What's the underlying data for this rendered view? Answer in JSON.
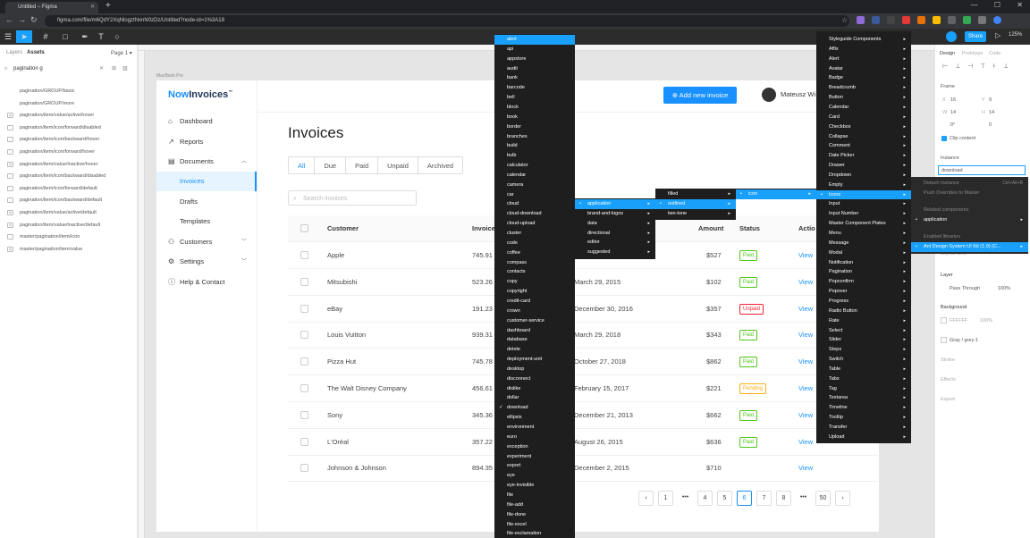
{
  "browser": {
    "tab_title": "Untitled – Figma",
    "new_tab": "+",
    "window_controls": "— ☐ ✕",
    "url": "figma.com/file/m6QdY2XqNlogztNxnN0zDz/Untitled?node-id=1%3A18"
  },
  "figma": {
    "share": "Share",
    "zoom": "125%",
    "left_tabs": [
      "Layers",
      "Assets"
    ],
    "page": "Page 1",
    "asset_search": "pagination g",
    "assets": [
      "pagination/GROUP/basic",
      "pagination/GROUP/more",
      "pagination/item/value/active/hover",
      "pagination/item/icon/forward/disabled",
      "pagination/item/icon/backward/hover",
      "pagination/item/icon/forward/hover",
      "pagination/item/value/inactive/hover",
      "pagination/item/icon/backward/disabled",
      "pagination/item/icon/forward/default",
      "pagination/item/icon/backward/default",
      "pagination/item/value/active/default",
      "pagination/item/value/inactive/default",
      "master/pagination/item/icon",
      "master/pagination/item/value"
    ],
    "asset_icons": [
      "",
      "",
      "99",
      "›",
      "‹",
      "›",
      "99",
      "‹",
      "›",
      "‹",
      "99",
      "99",
      "›",
      "99"
    ],
    "frame_label": "MacBook Pro",
    "right_tabs": [
      "Design",
      "Prototype",
      "Code"
    ],
    "frame_section": "Frame",
    "props": {
      "x": "16",
      "y": "9",
      "w": "14",
      "h": "14",
      "rot": "0°",
      "radius": "0"
    },
    "clip_content": "Clip content",
    "instance": "Instance",
    "instance_value": "download",
    "layer": "Layer",
    "pass_through": "Pass Through",
    "layer_opacity": "100%",
    "background": "Background",
    "bg_hex": "FFFFFF",
    "bg_opacity": "100%",
    "fill_style": "Gray / grey-1",
    "stroke": "Stroke",
    "effects": "Effects",
    "export": "Export",
    "faded_label": "Layout Grid"
  },
  "app": {
    "logo_a": "Now",
    "logo_b": "Invoices",
    "logo_tm": "™",
    "add_button": "Add new invoice",
    "user": "Mateusz Wi",
    "nav": {
      "dashboard": "Dashboard",
      "reports": "Reports",
      "documents": "Documents",
      "invoices": "Invoices",
      "drafts": "Drafts",
      "templates": "Templates",
      "customers": "Customers",
      "settings": "Settings",
      "help": "Help & Contact"
    },
    "title": "Invoices",
    "tabs": [
      "All",
      "Due",
      "Paid",
      "Unpaid",
      "Archived"
    ],
    "search_placeholder": "Search invoices",
    "columns": {
      "customer": "Customer",
      "invoice": "Invoice",
      "amount": "Amount",
      "status": "Status",
      "action": "Actio"
    },
    "rows": [
      {
        "customer": "Apple",
        "invoice": "745.91",
        "date": "",
        "amount": "$527",
        "status": "Paid",
        "action": "View"
      },
      {
        "customer": "Mitsubishi",
        "invoice": "523.26",
        "date": "March 29, 2015",
        "amount": "$102",
        "status": "Paid",
        "action": "View"
      },
      {
        "customer": "eBay",
        "invoice": "191.23",
        "date": "December 30, 2016",
        "amount": "$357",
        "status": "Unpaid",
        "action": "View"
      },
      {
        "customer": "Louis Vuitton",
        "invoice": "939.31",
        "date": "March 29, 2018",
        "amount": "$343",
        "status": "Paid",
        "action": "View"
      },
      {
        "customer": "Pizza Hut",
        "invoice": "745.78",
        "date": "October 27, 2018",
        "amount": "$862",
        "status": "Paid",
        "action": "View"
      },
      {
        "customer": "The Walt Disney Company",
        "invoice": "456.61",
        "date": "February 15, 2017",
        "amount": "$221",
        "status": "Pending",
        "action": "View"
      },
      {
        "customer": "Sony",
        "invoice": "345.36",
        "date": "December 21, 2013",
        "amount": "$662",
        "status": "Paid",
        "action": "View"
      },
      {
        "customer": "L'Oréal",
        "invoice": "357.22",
        "date": "August 26, 2015",
        "amount": "$636",
        "status": "Paid",
        "action": "View"
      },
      {
        "customer": "Johnson & Johnson",
        "invoice": "894.35",
        "date": "December 2, 2015",
        "amount": "$710",
        "status": "",
        "action": "View"
      }
    ],
    "pagination": [
      "‹",
      "1",
      "•••",
      "4",
      "5",
      "6",
      "7",
      "8",
      "•••",
      "50",
      "›"
    ],
    "current_page": "6"
  },
  "menus": {
    "icons_list": [
      "alert",
      "api",
      "appstore",
      "audit",
      "bank",
      "barcode",
      "bell",
      "block",
      "book",
      "border",
      "branches",
      "build",
      "bulb",
      "calculator",
      "calendar",
      "camera",
      "car",
      "cloud",
      "cloud-download",
      "cloud-upload",
      "cluster",
      "code",
      "coffee",
      "compass",
      "contacts",
      "copy",
      "copyright",
      "credit-card",
      "crown",
      "customer-service",
      "dashboard",
      "database",
      "delete",
      "deployment-unit",
      "desktop",
      "disconnect",
      "dislike",
      "dollar",
      "download",
      "ellipsis",
      "environment",
      "euro",
      "exception",
      "experiment",
      "export",
      "eye",
      "eye-invisible",
      "file",
      "file-add",
      "file-done",
      "file-excel",
      "file-exclamation"
    ],
    "icons_highlight": "alert",
    "icons_checked": "download",
    "categories": [
      "application",
      "brand-and-logos",
      "data",
      "directional",
      "editor",
      "suggested"
    ],
    "styles": [
      "filled",
      "outlined",
      "two-tone"
    ],
    "icon_item": "icon",
    "components": [
      "Styleguide Components",
      "Affix",
      "Alert",
      "Avatar",
      "Badge",
      "Breadcrumb",
      "Button",
      "Calendar",
      "Card",
      "Checkbox",
      "Collapse",
      "Comment",
      "Date Picker",
      "Drawer",
      "Dropdown",
      "Empty",
      "Icons",
      "Input",
      "Input Number",
      "Master Component Plates",
      "Menu",
      "Message",
      "Modal",
      "Notification",
      "Pagination",
      "Popconfirm",
      "Popover",
      "Progress",
      "Radio Button",
      "Rate",
      "Select",
      "Slider",
      "Steps",
      "Switch",
      "Table",
      "Tabs",
      "Tag",
      "Textarea",
      "Timeline",
      "Tooltip",
      "Transfer",
      "Upload"
    ],
    "components_highlight": "Icons",
    "instance_menu": {
      "detach": "Detach Instance",
      "detach_key": "Ctrl+Alt+B",
      "push": "Push Overrides to Master",
      "related": "Related components",
      "application": "application",
      "enabled": "Enabled libraries",
      "library": "Ant Design System UI Kit (1.0) (C..."
    }
  }
}
